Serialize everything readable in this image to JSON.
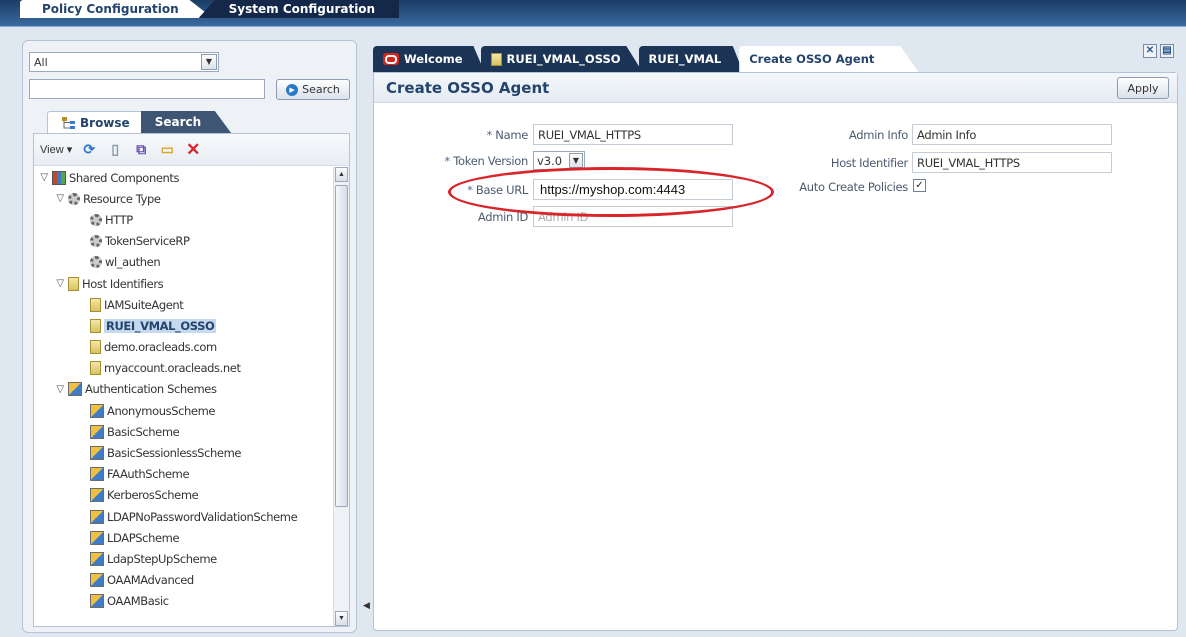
{
  "header": {
    "tabs": [
      {
        "label": "Policy Configuration",
        "active": true
      },
      {
        "label": "System Configuration",
        "active": false
      }
    ]
  },
  "left": {
    "scope_select": "All",
    "search_value": "",
    "search_button": "Search",
    "tabs": [
      {
        "label": "Browse",
        "active": true
      },
      {
        "label": "Search",
        "active": false
      }
    ],
    "view_menu": "View ▾",
    "tree": [
      {
        "label": "Shared Components",
        "level": 0,
        "icon": "components-icon",
        "toggle": "▽"
      },
      {
        "label": "Resource Type",
        "level": 1,
        "icon": "gear-icon",
        "toggle": "▽"
      },
      {
        "label": "HTTP",
        "level": 2,
        "icon": "gear-icon"
      },
      {
        "label": "TokenServiceRP",
        "level": 2,
        "icon": "gear-icon"
      },
      {
        "label": "wl_authen",
        "level": 2,
        "icon": "gear-icon"
      },
      {
        "label": "Host Identifiers",
        "level": 1,
        "icon": "page-icon",
        "toggle": "▽"
      },
      {
        "label": "IAMSuiteAgent",
        "level": 2,
        "icon": "page-icon"
      },
      {
        "label": "RUEI_VMAL_OSSO",
        "level": 2,
        "icon": "page-icon",
        "selected": true
      },
      {
        "label": "demo.oracleads.com",
        "level": 2,
        "icon": "page-icon"
      },
      {
        "label": "myaccount.oracleads.net",
        "level": 2,
        "icon": "page-icon"
      },
      {
        "label": "Authentication Schemes",
        "level": 1,
        "icon": "scheme-icon",
        "toggle": "▽"
      },
      {
        "label": "AnonymousScheme",
        "level": 2,
        "icon": "scheme-icon"
      },
      {
        "label": "BasicScheme",
        "level": 2,
        "icon": "scheme-icon"
      },
      {
        "label": "BasicSessionlessScheme",
        "level": 2,
        "icon": "scheme-icon"
      },
      {
        "label": "FAAuthScheme",
        "level": 2,
        "icon": "scheme-icon"
      },
      {
        "label": "KerberosScheme",
        "level": 2,
        "icon": "scheme-icon"
      },
      {
        "label": "LDAPNoPasswordValidationScheme",
        "level": 2,
        "icon": "scheme-icon"
      },
      {
        "label": "LDAPScheme",
        "level": 2,
        "icon": "scheme-icon"
      },
      {
        "label": "LdapStepUpScheme",
        "level": 2,
        "icon": "scheme-icon"
      },
      {
        "label": "OAAMAdvanced",
        "level": 2,
        "icon": "scheme-icon"
      },
      {
        "label": "OAAMBasic",
        "level": 2,
        "icon": "scheme-icon"
      }
    ]
  },
  "doc_tabs": [
    {
      "label": "Welcome",
      "icon": "oracle-icon",
      "active": false
    },
    {
      "label": "RUEI_VMAL_OSSO",
      "icon": "page-icon",
      "active": false
    },
    {
      "label": "RUEI_VMAL",
      "icon": "",
      "active": false
    },
    {
      "label": "Create OSSO Agent",
      "icon": "",
      "active": true
    }
  ],
  "form": {
    "title": "Create OSSO Agent",
    "apply_label": "Apply",
    "required_mark": "*",
    "name_label": "Name",
    "name_value": "RUEI_VMAL_HTTPS",
    "token_version_label": "Token Version",
    "token_version_value": "v3.0",
    "base_url_label": "Base URL",
    "base_url_value": "https://myshop.com:4443",
    "admin_id_label": "Admin ID",
    "admin_id_value": "Admin ID",
    "admin_info_label": "Admin Info",
    "admin_info_value": "Admin Info",
    "host_identifier_label": "Host Identifier",
    "host_identifier_value": "RUEI_VMAL_HTTPS",
    "auto_create_label": "Auto Create Policies",
    "auto_create_checked": true,
    "checkmark": "✓"
  },
  "colors": {
    "accent": "#23446d",
    "annotation": "#d8252a",
    "header_bg": "#1b3d66"
  }
}
